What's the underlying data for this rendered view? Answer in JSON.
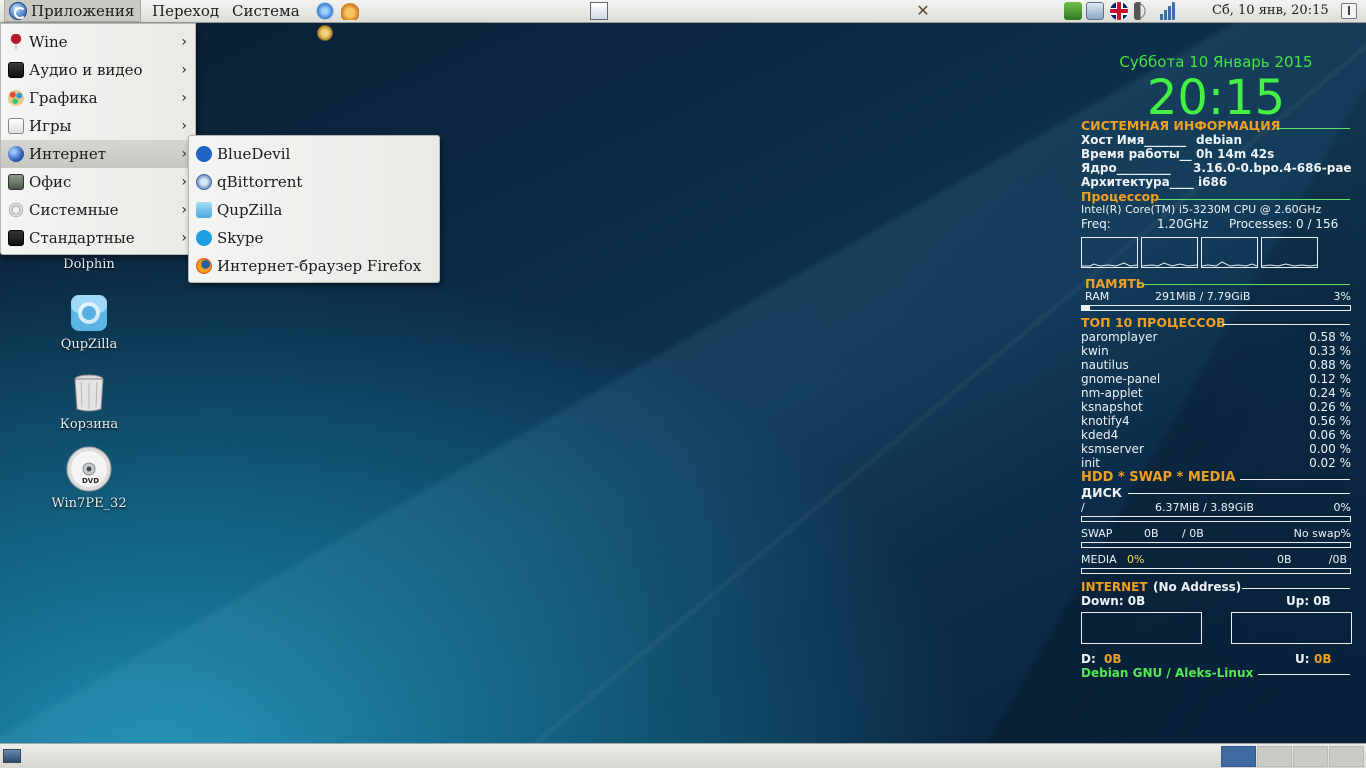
{
  "top_panel": {
    "menus": {
      "applications": "Приложения",
      "go": "Переход",
      "system": "Система"
    },
    "clock": "Сб, 10 янв, 20:15",
    "launchers": [
      "network-icon",
      "mail-icon",
      "settings-icon"
    ],
    "tray": [
      "keyboard-icon",
      "network-manager-icon",
      "uk-flag-icon",
      "volume-icon",
      "signal-icon"
    ]
  },
  "apps_menu": {
    "items": [
      {
        "label": "Wine",
        "icon": "wine-icon"
      },
      {
        "label": "Аудио и видео",
        "icon": "multimedia-icon"
      },
      {
        "label": "Графика",
        "icon": "graphics-icon"
      },
      {
        "label": "Игры",
        "icon": "games-icon"
      },
      {
        "label": "Интернет",
        "icon": "internet-icon"
      },
      {
        "label": "Офис",
        "icon": "office-icon"
      },
      {
        "label": "Системные",
        "icon": "system-icon"
      },
      {
        "label": "Стандартные",
        "icon": "accessories-icon"
      }
    ],
    "active_index": 4
  },
  "internet_submenu": {
    "items": [
      {
        "label": "BlueDevil",
        "icon": "bluetooth-icon"
      },
      {
        "label": "qBittorrent",
        "icon": "qbittorrent-icon"
      },
      {
        "label": "QupZilla",
        "icon": "qupzilla-icon"
      },
      {
        "label": "Skype",
        "icon": "skype-icon"
      },
      {
        "label": "Интернет-браузер Firefox",
        "icon": "firefox-icon"
      }
    ]
  },
  "desktop": {
    "icons": [
      {
        "label": "Dolphin",
        "icon": "folder-icon"
      },
      {
        "label": "QupZilla",
        "icon": "qupzilla-icon"
      },
      {
        "label": "Корзина",
        "icon": "trash-icon"
      },
      {
        "label": "Win7PE_32",
        "icon": "dvd-icon"
      }
    ]
  },
  "conky": {
    "date": "Суббота 10 Январь 2015",
    "time": "20:15",
    "sysinfo": {
      "title": "СИСТЕМНАЯ ИНФОРМАЦИЯ",
      "host_label": "Хост Имя_______",
      "host": "debian",
      "uptime_label": "Время работы__",
      "uptime": "0h 14m 42s",
      "kernel_label": "Ядро_________",
      "kernel": "3.16.0-0.bpo.4-686-pae",
      "arch_label": "Архитектура____",
      "arch": "i686"
    },
    "cpu": {
      "title": "Процессор",
      "model": "Intel(R) Core(TM) i5-3230M CPU @ 2.60GHz",
      "freq_label": "Freq:",
      "freq": "1.20GHz",
      "processes_label": "Processes:",
      "processes": "0  / 156"
    },
    "memory": {
      "title": "ПАМЯТЬ",
      "ram_label": "RAM",
      "ram_used": "291MiB  / 7.79GiB",
      "ram_percent": "3%",
      "ram_fraction": 0.03
    },
    "top": {
      "title": "ТОП 10 ПРОЦЕССОВ",
      "processes": [
        {
          "name": "paromplayer",
          "cpu": "0.58 %"
        },
        {
          "name": "kwin",
          "cpu": "0.33 %"
        },
        {
          "name": "nautilus",
          "cpu": "0.88 %"
        },
        {
          "name": "gnome-panel",
          "cpu": "0.12 %"
        },
        {
          "name": "nm-applet",
          "cpu": "0.24 %"
        },
        {
          "name": "ksnapshot",
          "cpu": "0.26 %"
        },
        {
          "name": "knotify4",
          "cpu": "0.56 %"
        },
        {
          "name": "kded4",
          "cpu": "0.06 %"
        },
        {
          "name": "ksmserver",
          "cpu": "0.00 %"
        },
        {
          "name": "init",
          "cpu": "0.02 %"
        }
      ]
    },
    "storage": {
      "title": "HDD * SWAP * MEDIA",
      "disk_title": "ДИСК",
      "root_label": "/",
      "root_used": "6.37MiB / 3.89GiB",
      "root_percent": "0%",
      "swap_label": "SWAP",
      "swap_used": "0B",
      "swap_total": "/ 0B",
      "swap_status": "No swap%",
      "media_label": "MEDIA",
      "media_percent": "0%",
      "media_used": "0B",
      "media_total": "/0B"
    },
    "network": {
      "title": "INTERNET",
      "address": "(No Address)",
      "down_label": "Down: 0B",
      "up_label": "Up: 0B",
      "d_label": "D:",
      "d_value": "0B",
      "u_label": "U:",
      "u_value": "0B"
    },
    "footer": "Debian GNU / Aleks-Linux"
  },
  "bottom_panel": {
    "workspaces": 4,
    "active_workspace": 1
  },
  "colors": {
    "conky_green": "#44f044",
    "conky_orange": "#f0a020",
    "workspace_active": "#3e6b9f"
  }
}
